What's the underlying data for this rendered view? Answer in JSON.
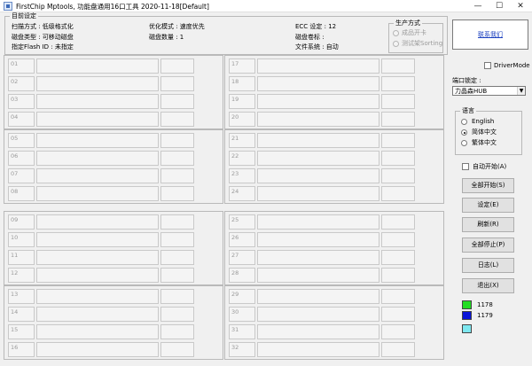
{
  "window": {
    "title": "FirstChip Mptools, 功能盘通用16口工具     2020-11-18[Default]",
    "minimize": "—",
    "maximize": "☐",
    "close": "✕"
  },
  "settings": {
    "legend": "目前设定",
    "scan_mode": "扫描方式 : 低级格式化",
    "disk_type": "磁盘类型 : 可移动磁盘",
    "flash_id": "指定Flash ID : 未指定",
    "opt_mode": "优化模式 : 速度优先",
    "disk_count": "磁盘数量 : 1",
    "ecc": "ECC 设定 : 12",
    "volume_label": "磁盘卷标 :",
    "file_system": "文件系统 : 自动"
  },
  "production": {
    "legend": "生产方式",
    "options": [
      "成品开卡",
      "测试架Sorting"
    ]
  },
  "port_groups": [
    {
      "ports": [
        "01",
        "02",
        "03",
        "04"
      ]
    },
    {
      "ports": [
        "17",
        "18",
        "19",
        "20"
      ]
    },
    {
      "ports": [
        "05",
        "06",
        "07",
        "08"
      ]
    },
    {
      "ports": [
        "21",
        "22",
        "23",
        "24"
      ]
    },
    {
      "ports": [
        "09",
        "10",
        "11",
        "12"
      ]
    },
    {
      "ports": [
        "25",
        "26",
        "27",
        "28"
      ]
    },
    {
      "ports": [
        "13",
        "14",
        "15",
        "16"
      ]
    },
    {
      "ports": [
        "29",
        "30",
        "31",
        "32"
      ]
    }
  ],
  "sidebar": {
    "link": "联系我们",
    "drivermode": "DriverMode",
    "port_lock_label": "端口锁定 :",
    "port_lock_value": "力晶森HUB",
    "language_legend": "语言",
    "languages": [
      "English",
      "简体中文",
      "繁体中文"
    ],
    "selected_language": "简体中文",
    "auto_start": "自动开始(A)",
    "buttons": [
      "全部开始(S)",
      "设定(E)",
      "刷新(R)",
      "全部停止(P)",
      "日志(L)",
      "退出(X)"
    ],
    "legend_items": [
      {
        "label": "1178",
        "color": "#22dd22"
      },
      {
        "label": "1179",
        "color": "#0a14d8"
      },
      {
        "label": "",
        "color": "#7ee8f0"
      }
    ]
  }
}
